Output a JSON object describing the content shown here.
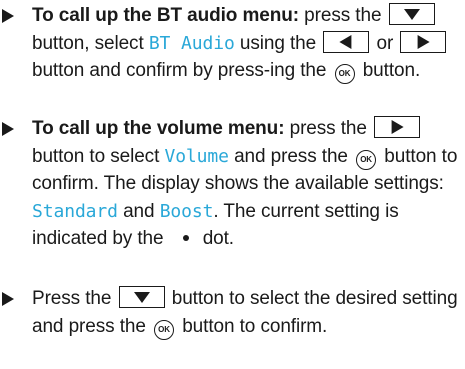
{
  "colors": {
    "display_text": "#2aa8d8",
    "text": "#1a1a1a"
  },
  "icons": {
    "bullet": "right-triangle-arrow",
    "down_key": "down-arrow-key",
    "left_key": "left-arrow-key",
    "right_key": "right-arrow-key",
    "ok_key": "ok-button",
    "selection_dot": "dot"
  },
  "ok_label": "OK",
  "steps": [
    {
      "heading": "To call up the BT audio menu:",
      "t1": " press the",
      "t2": "button, select",
      "display1": "BT Audio",
      "t3": "using the",
      "t4": "or",
      "t5": "button and confirm by press-ing the",
      "t6": "button."
    },
    {
      "heading": "To call up the volume menu:",
      "t1": " press the",
      "t2": "button to select",
      "display1": "Volume",
      "t3": "and press the",
      "t4": "button to confirm.",
      "t5": "The display shows the available settings:",
      "display2": "Standard",
      "t6": "and",
      "display3": "Boost",
      "t7": ". The current setting is indicated by the",
      "t8": "dot."
    },
    {
      "t1": "Press the",
      "t2": "button to select the desired setting and press the",
      "t3": "button to confirm."
    }
  ]
}
